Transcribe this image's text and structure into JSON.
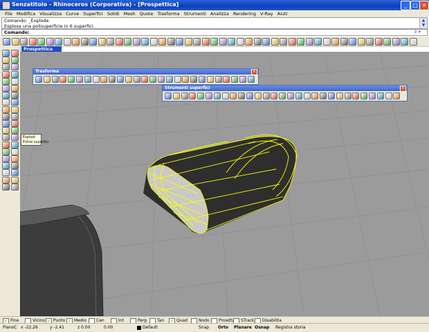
{
  "window": {
    "title": "Senzatitolo - Rhinoceros (Corporativa) - [Prospettica]",
    "minimize": "_",
    "maximize": "□",
    "close": "×"
  },
  "menu": [
    "File",
    "Modifica",
    "Visualizza",
    "Curve",
    "Superfici",
    "Solidi",
    "Mesh",
    "Quote",
    "Trasforma",
    "Strumenti",
    "Analizza",
    "Rendering",
    "V-Ray",
    "Aiuti"
  ],
  "command": {
    "history": [
      "Comando: _Explode",
      "Esplosa una polisuperficie in 6 superfici."
    ],
    "prompt": "Comando:",
    "input_value": ""
  },
  "viewport": {
    "tab_label": "Prospettica"
  },
  "toolbars": {
    "trasforma": {
      "title": "Trasforma",
      "close": "×"
    },
    "strumenti_superfici": {
      "title": "Strumenti superfici",
      "close": "×"
    }
  },
  "popup": {
    "items": [
      "Esplodi",
      "Estrai superfici"
    ]
  },
  "osnaps": [
    {
      "label": "Fine",
      "checked": true
    },
    {
      "label": "Vicino",
      "checked": false
    },
    {
      "label": "Punto",
      "checked": true
    },
    {
      "label": "Medio",
      "checked": true
    },
    {
      "label": "Cen",
      "checked": false
    },
    {
      "label": "Int",
      "checked": false
    },
    {
      "label": "Perp",
      "checked": false
    },
    {
      "label": "Tan",
      "checked": false
    },
    {
      "label": "Quad",
      "checked": true
    },
    {
      "label": "Nodo",
      "checked": false
    },
    {
      "label": "Proietta",
      "checked": false
    },
    {
      "label": "STrack",
      "checked": false
    },
    {
      "label": "Disabilita",
      "checked": false
    }
  ],
  "status": {
    "cplane": "PianoC",
    "x": "x -22.26",
    "y": "y -2.41",
    "z": "z 0.00",
    "extra": "0.00",
    "layer": "Default",
    "snap": "Snap",
    "orto": "Orto",
    "planare": "Planare",
    "osnap": "Osnap",
    "history": "Registra storia"
  },
  "colors": {
    "titlebar": "#0a3fb8",
    "viewport_bg": "#9b9b9b",
    "selection_highlight": "#ffff00",
    "viewport_tab": "#1f4dbf"
  }
}
